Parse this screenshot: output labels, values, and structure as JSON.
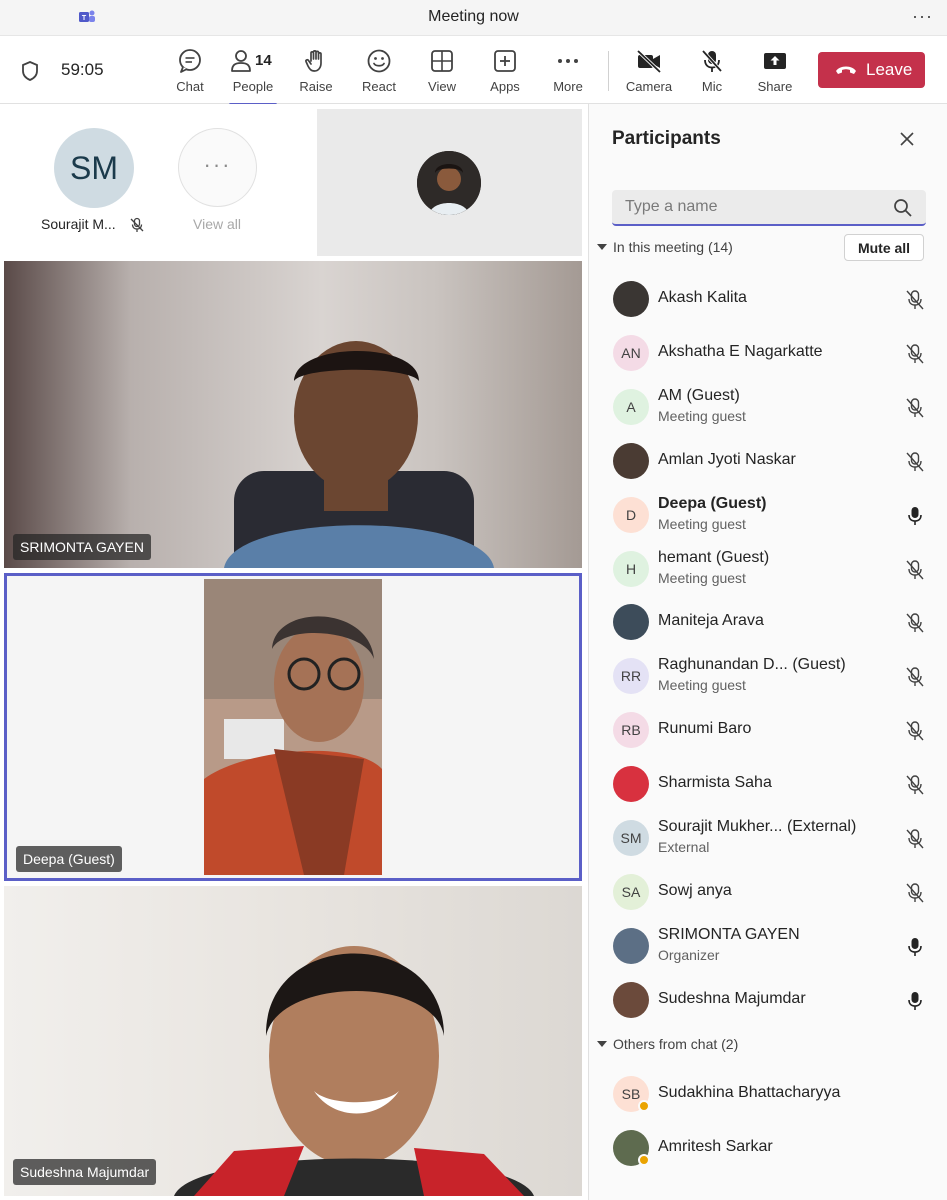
{
  "titlebar": {
    "title": "Meeting now",
    "more": "···"
  },
  "toolbar": {
    "timer": "59:05",
    "chat": "Chat",
    "people": "People",
    "people_count": "14",
    "raise": "Raise",
    "react": "React",
    "view": "View",
    "apps": "Apps",
    "more": "More",
    "camera": "Camera",
    "mic": "Mic",
    "share": "Share",
    "leave": "Leave",
    "leave_color": "#c4314b",
    "accent_color": "#5b5fc7"
  },
  "stage": {
    "strip_initials": "SM",
    "strip_name": "Sourajit M...",
    "view_all": "View all",
    "tile1_name": "SRIMONTA GAYEN",
    "tile2_name": "Deepa (Guest)",
    "tile3_name": "Sudeshna Majumdar"
  },
  "panel": {
    "title": "Participants",
    "search_placeholder": "Type a name",
    "in_meeting_header": "In this meeting (14)",
    "mute_all": "Mute all",
    "others_header": "Others from chat (2)",
    "participants": [
      {
        "name": "Akash Kalita",
        "initials": "",
        "sub": "",
        "mic": "muted",
        "avatar_color": "#3a3633"
      },
      {
        "name": "Akshatha E Nagarkatte",
        "initials": "AN",
        "sub": "",
        "mic": "muted",
        "avatar_color": "#f4dbe6"
      },
      {
        "name": "AM (Guest)",
        "initials": "A",
        "sub": "Meeting guest",
        "mic": "muted",
        "avatar_color": "#dff2e0"
      },
      {
        "name": "Amlan Jyoti Naskar",
        "initials": "",
        "sub": "",
        "mic": "muted",
        "avatar_color": "#4a3b33"
      },
      {
        "name": "Deepa (Guest)",
        "initials": "D",
        "sub": "Meeting guest",
        "mic": "on",
        "avatar_color": "#fde0d4"
      },
      {
        "name": "hemant (Guest)",
        "initials": "H",
        "sub": "Meeting guest",
        "mic": "muted",
        "avatar_color": "#dff2e0"
      },
      {
        "name": "Maniteja Arava",
        "initials": "",
        "sub": "",
        "mic": "muted",
        "avatar_color": "#3d4c5a"
      },
      {
        "name": "Raghunandan D... (Guest)",
        "initials": "RR",
        "sub": "Meeting guest",
        "mic": "muted",
        "avatar_color": "#e4e2f5"
      },
      {
        "name": "Runumi Baro",
        "initials": "RB",
        "sub": "",
        "mic": "muted",
        "avatar_color": "#f4dbe6"
      },
      {
        "name": "Sharmista Saha",
        "initials": "",
        "sub": "",
        "mic": "muted",
        "avatar_color": "#d8313f"
      },
      {
        "name": "Sourajit Mukher... (External)",
        "initials": "SM",
        "sub": "External",
        "mic": "muted",
        "avatar_color": "#cfdbe2"
      },
      {
        "name": "Sowj anya",
        "initials": "SA",
        "sub": "",
        "mic": "muted",
        "avatar_color": "#e3f0d8"
      },
      {
        "name": "SRIMONTA GAYEN",
        "initials": "",
        "sub": "Organizer",
        "mic": "on",
        "avatar_color": "#5c6f85"
      },
      {
        "name": "Sudeshna Majumdar",
        "initials": "",
        "sub": "",
        "mic": "on",
        "avatar_color": "#6b4a3b"
      }
    ],
    "others": [
      {
        "name": "Sudakhina Bhattacharyya",
        "initials": "SB",
        "avatar_color": "#fde0d4"
      },
      {
        "name": "Amritesh Sarkar",
        "initials": "",
        "avatar_color": "#5e6b4f"
      }
    ]
  }
}
